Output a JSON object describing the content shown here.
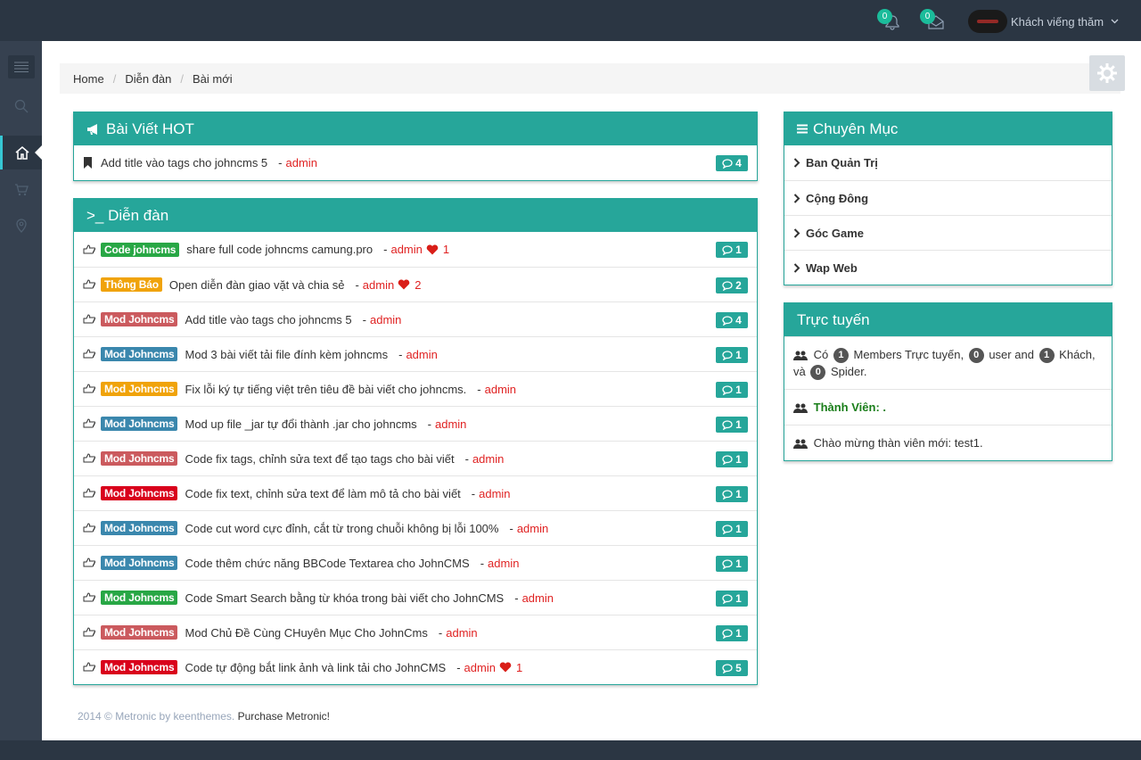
{
  "topbar": {
    "notification_count": "0",
    "message_count": "0",
    "username": "Khách viếng thăm"
  },
  "breadcrumb": [
    "Home",
    "Diễn đàn",
    "Bài mới"
  ],
  "hot": {
    "title": "Bài Viết HOT",
    "items": [
      {
        "title": "Add title vào tags cho johncms 5",
        "author": "admin",
        "count": "4"
      }
    ]
  },
  "forum": {
    "title": ">_ Diễn đàn",
    "items": [
      {
        "label": "Code johncms",
        "label_color": "#28a745",
        "title": "share full code johncms camung.pro",
        "author": "admin",
        "likes": "1",
        "count": "1"
      },
      {
        "label": "Thông Báo",
        "label_color": "#f0a30a",
        "title": "Open diễn đàn giao vặt và chia sẻ",
        "author": "admin",
        "likes": "2",
        "count": "2"
      },
      {
        "label": "Mod Johncms",
        "label_color": "#cb5a5e",
        "title": "Add title vào tags cho johncms 5",
        "author": "admin",
        "likes": "",
        "count": "4"
      },
      {
        "label": "Mod Johncms",
        "label_color": "#3a87ad",
        "title": "Mod 3 bài viết tải file đính kèm johncms",
        "author": "admin",
        "likes": "",
        "count": "1"
      },
      {
        "label": "Mod Johncms",
        "label_color": "#f0a30a",
        "title": "Fix lỗi ký tự tiếng việt trên tiêu đề bài viết cho johncms.",
        "author": "admin",
        "likes": "",
        "count": "1"
      },
      {
        "label": "Mod Johncms",
        "label_color": "#3a87ad",
        "title": "Mod up file _jar tự đổi thành .jar cho johncms",
        "author": "admin",
        "likes": "",
        "count": "1"
      },
      {
        "label": "Mod Johncms",
        "label_color": "#cb5a5e",
        "title": "Code fix tags, chỉnh sửa text để tạo tags cho bài viết",
        "author": "admin",
        "likes": "",
        "count": "1"
      },
      {
        "label": "Mod Johncms",
        "label_color": "#d9001b",
        "title": "Code fix text, chỉnh sửa text để làm mô tả cho bài viết",
        "author": "admin",
        "likes": "",
        "count": "1"
      },
      {
        "label": "Mod Johncms",
        "label_color": "#3a87ad",
        "title": "Code cut word cực đỉnh, cắt từ trong chuỗi không bị lỗi 100%",
        "author": "admin",
        "likes": "",
        "count": "1"
      },
      {
        "label": "Mod Johncms",
        "label_color": "#3a87ad",
        "title": "Code thêm chức năng BBCode Textarea cho JohnCMS",
        "author": "admin",
        "likes": "",
        "count": "1"
      },
      {
        "label": "Mod Johncms",
        "label_color": "#28a745",
        "title": "Code Smart Search bằng từ khóa trong bài viết cho JohnCMS",
        "author": "admin",
        "likes": "",
        "count": "1"
      },
      {
        "label": "Mod Johncms",
        "label_color": "#cb5a5e",
        "title": "Mod Chủ Đề Cùng CHuyên Mục Cho JohnCms",
        "author": "admin",
        "likes": "",
        "count": "1"
      },
      {
        "label": "Mod Johncms",
        "label_color": "#d9001b",
        "title": "Code tự động bắt link ảnh và link tải cho JohnCMS",
        "author": "admin",
        "likes": "1",
        "count": "5"
      }
    ]
  },
  "categories": {
    "title": "Chuyên Mục",
    "items": [
      "Ban Quản Trị",
      "Cộng Đông",
      "Góc Game",
      "Wap Web"
    ]
  },
  "online": {
    "title": "Trực tuyến",
    "prefix": "Có",
    "members": "1",
    "members_text": "Members Trực tuyến,",
    "users": "0",
    "users_text": "user and",
    "guests": "1",
    "guests_text": "Khách, và",
    "spiders": "0",
    "spiders_text": "Spider.",
    "member_title": "Thành Viên: .",
    "welcome": "Chào mừng thàn viên mới: test1."
  },
  "footer": {
    "copyright": "2014 © Metronic by keenthemes.",
    "purchase": "Purchase Metronic!"
  },
  "colors": {
    "accent": "#26a69a",
    "author": "#e02222",
    "topbar": "#2b3643"
  }
}
